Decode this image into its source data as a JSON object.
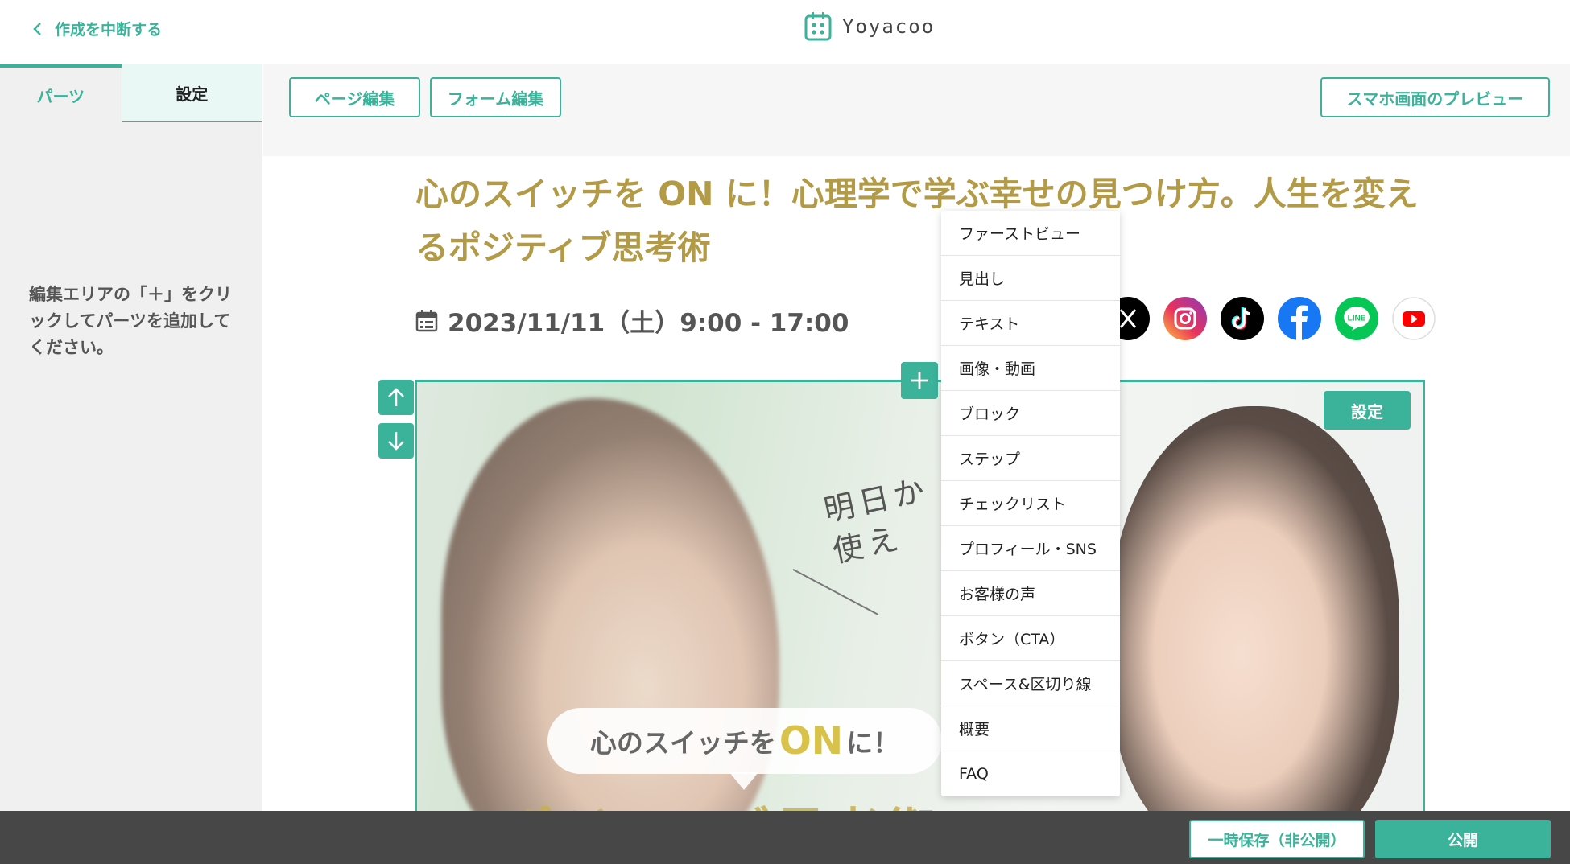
{
  "header": {
    "back_label": "作成を中断する",
    "logo_text": "Yoyacoo"
  },
  "sidebar": {
    "tabs": [
      {
        "label": "パーツ",
        "active": true
      },
      {
        "label": "設定",
        "active": false
      }
    ],
    "hint": "編集エリアの「＋」をクリックしてパーツを追加してください。"
  },
  "toolbar": {
    "page_edit": "ページ編集",
    "form_edit": "フォーム編集",
    "mobile_preview": "スマホ画面のプレビュー"
  },
  "event": {
    "title": "心のスイッチを ON に！心理学で学ぶ幸せの見つけ方。人生を変えるポジティブ思考術",
    "datetime": "2023/11/11（土）9:00 - 17:00"
  },
  "hero": {
    "handwriting": "明日か\n使え",
    "bubble_prefix": "心のスイッチを",
    "bubble_on": "ON",
    "bubble_suffix": "に！",
    "big_text": "ポジティブ思考術",
    "settings_label": "設定"
  },
  "menu": {
    "items": [
      "ファーストビュー",
      "見出し",
      "テキスト",
      "画像・動画",
      "ブロック",
      "ステップ",
      "チェックリスト",
      "プロフィール・SNS",
      "お客様の声",
      "ボタン（CTA）",
      "スペース&区切り線",
      "概要",
      "FAQ"
    ]
  },
  "sns": [
    "x-icon",
    "instagram-icon",
    "tiktok-icon",
    "facebook-icon",
    "line-icon",
    "youtube-icon"
  ],
  "footer": {
    "draft_label": "一時保存（非公開）",
    "publish_label": "公開"
  },
  "colors": {
    "accent": "#3bb29a",
    "title": "#b29a46",
    "bottom_bar": "#474747"
  }
}
